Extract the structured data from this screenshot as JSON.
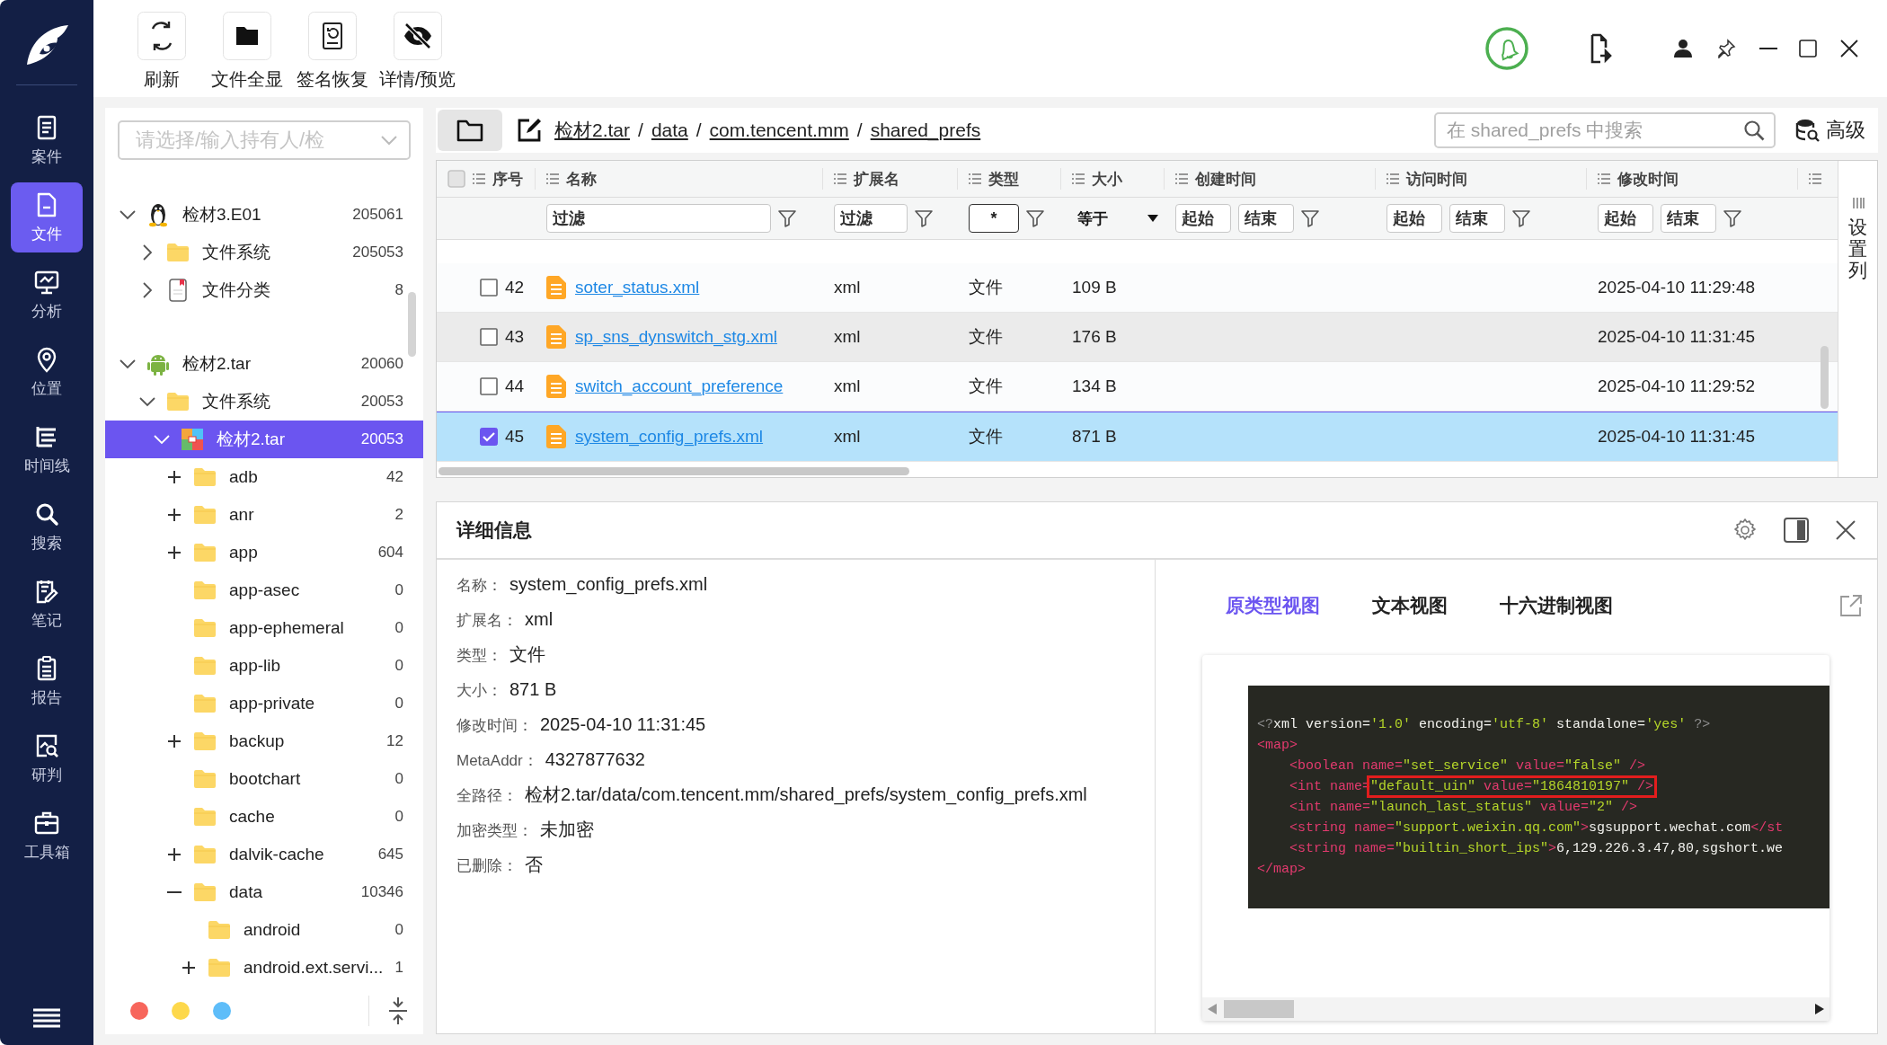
{
  "nav": {
    "items": [
      {
        "label": "案件",
        "selected": false
      },
      {
        "label": "文件",
        "selected": true
      },
      {
        "label": "分析",
        "selected": false
      },
      {
        "label": "位置",
        "selected": false
      },
      {
        "label": "时间线",
        "selected": false
      },
      {
        "label": "搜索",
        "selected": false
      },
      {
        "label": "笔记",
        "selected": false
      },
      {
        "label": "报告",
        "selected": false
      },
      {
        "label": "研判",
        "selected": false
      },
      {
        "label": "工具箱",
        "selected": false
      }
    ]
  },
  "toolbar": {
    "buttons": [
      "刷新",
      "文件全显",
      "签名恢复",
      "详情/预览"
    ]
  },
  "case_selector": {
    "placeholder": "请选择/输入持有人/检"
  },
  "tree": [
    {
      "label": "检材3.E01",
      "count": "205061",
      "kind": "penguin",
      "expanded": true,
      "selected": false,
      "children": [
        {
          "label": "文件系统",
          "count": "205053",
          "kind": "folder",
          "expanded": false,
          "selected": false
        },
        {
          "label": "文件分类",
          "count": "8",
          "kind": "document",
          "expanded": false,
          "selected": false
        }
      ]
    },
    {
      "label": "检材2.tar",
      "count": "20060",
      "kind": "android",
      "expanded": true,
      "selected": false,
      "children": [
        {
          "label": "文件系统",
          "count": "20053",
          "kind": "folder",
          "expanded": true,
          "selected": false,
          "children": [
            {
              "label": "检材2.tar",
              "count": "20053",
              "kind": "archive",
              "expanded": true,
              "selected": true,
              "children": [
                {
                  "label": "adb",
                  "count": "42",
                  "kind": "folder",
                  "expanded": false,
                  "selected": false
                },
                {
                  "label": "anr",
                  "count": "2",
                  "kind": "folder",
                  "expanded": false,
                  "selected": false
                },
                {
                  "label": "app",
                  "count": "604",
                  "kind": "folder",
                  "expanded": false,
                  "selected": false
                },
                {
                  "label": "app-asec",
                  "count": "0",
                  "kind": "folder",
                  "selected": false
                },
                {
                  "label": "app-ephemeral",
                  "count": "0",
                  "kind": "folder",
                  "selected": false
                },
                {
                  "label": "app-lib",
                  "count": "0",
                  "kind": "folder",
                  "selected": false
                },
                {
                  "label": "app-private",
                  "count": "0",
                  "kind": "folder",
                  "selected": false
                },
                {
                  "label": "backup",
                  "count": "12",
                  "kind": "folder",
                  "expanded": false,
                  "selected": false
                },
                {
                  "label": "bootchart",
                  "count": "0",
                  "kind": "folder",
                  "selected": false
                },
                {
                  "label": "cache",
                  "count": "0",
                  "kind": "folder",
                  "selected": false
                },
                {
                  "label": "dalvik-cache",
                  "count": "645",
                  "kind": "folder",
                  "expanded": false,
                  "selected": false
                },
                {
                  "label": "data",
                  "count": "10346",
                  "kind": "folder",
                  "expanded": true,
                  "selected": false,
                  "children": [
                    {
                      "label": "android",
                      "count": "0",
                      "kind": "folder",
                      "selected": false
                    },
                    {
                      "label": "android.ext.servi...",
                      "count": "1",
                      "kind": "folder",
                      "expanded": false,
                      "selected": false
                    }
                  ]
                }
              ]
            }
          ]
        }
      ]
    }
  ],
  "tree_footer": {
    "dots": [
      {
        "color": "#f7665c"
      },
      {
        "color": "#fdd84b"
      },
      {
        "color": "#5ebdf9"
      }
    ]
  },
  "path_bar": {
    "crumbs": [
      "检材2.tar",
      "data",
      "com.tencent.mm",
      "shared_prefs"
    ],
    "separator": "/",
    "search": {
      "placeholder": "在 shared_prefs 中搜索"
    },
    "advanced": "高级"
  },
  "table": {
    "select_all": {
      "checked": false
    },
    "columns": [
      "序号",
      "名称",
      "扩展名",
      "类型",
      "大小",
      "创建时间",
      "访问时间",
      "修改时间"
    ],
    "filters": [
      {
        "kind": "none"
      },
      {
        "kind": "text",
        "placeholder": "过滤"
      },
      {
        "kind": "text",
        "placeholder": "过滤"
      },
      {
        "kind": "value",
        "value": "*"
      },
      {
        "kind": "select",
        "value": "等于"
      },
      {
        "kind": "range",
        "fields": [
          {
            "placeholder": "起始"
          },
          {
            "placeholder": "结束"
          }
        ]
      },
      {
        "kind": "range",
        "fields": [
          {
            "placeholder": "起始"
          },
          {
            "placeholder": "结束"
          }
        ]
      },
      {
        "kind": "range",
        "fields": [
          {
            "placeholder": "起始"
          },
          {
            "placeholder": "结束"
          }
        ]
      }
    ],
    "rows": [
      {
        "index": "42",
        "checked": false,
        "selected": false,
        "hovered": false,
        "name": "soter_status.xml",
        "ext": "xml",
        "type": "文件",
        "size": "109 B",
        "modified": "2025-04-10 11:29:48"
      },
      {
        "index": "43",
        "checked": false,
        "selected": false,
        "hovered": true,
        "name": "sp_sns_dynswitch_stg.xml",
        "ext": "xml",
        "type": "文件",
        "size": "176 B",
        "modified": "2025-04-10 11:31:45"
      },
      {
        "index": "44",
        "checked": false,
        "selected": false,
        "hovered": false,
        "name": "switch_account_preference",
        "ext": "xml",
        "type": "文件",
        "size": "134 B",
        "modified": "2025-04-10 11:29:52"
      },
      {
        "index": "45",
        "checked": true,
        "selected": true,
        "hovered": false,
        "name": "system_config_prefs.xml",
        "ext": "xml",
        "type": "文件",
        "size": "871 B",
        "modified": "2025-04-10 11:31:45"
      }
    ],
    "side_label": "设置列"
  },
  "detail": {
    "title": "详细信息",
    "fields": [
      {
        "label": "名称：",
        "value": "system_config_prefs.xml"
      },
      {
        "label": "扩展名：",
        "value": "xml"
      },
      {
        "label": "类型：",
        "value": "文件"
      },
      {
        "label": "大小：",
        "value": "871 B"
      },
      {
        "label": "修改时间：",
        "value": "2025-04-10 11:31:45"
      },
      {
        "label": "MetaAddr：",
        "value": "4327877632"
      },
      {
        "label": "全路径：",
        "value": "检材2.tar/data/com.tencent.mm/shared_prefs/system_config_prefs.xml"
      },
      {
        "label": "加密类型：",
        "value": "未加密"
      },
      {
        "label": "已删除：",
        "value": "否"
      }
    ],
    "tabs": [
      {
        "label": "原类型视图",
        "selected": true
      },
      {
        "label": "文本视图",
        "selected": false
      },
      {
        "label": "十六进制视图",
        "selected": false
      }
    ],
    "code_lines": [
      [
        {
          "t": "<?",
          "kind": "punct"
        },
        {
          "t": "xml version=",
          "kind": "plain"
        },
        {
          "t": "'1.0'",
          "kind": "value"
        },
        {
          "t": " encoding=",
          "kind": "plain"
        },
        {
          "t": "'utf-8'",
          "kind": "value"
        },
        {
          "t": " standalone=",
          "kind": "plain"
        },
        {
          "t": "'yes'",
          "kind": "value"
        },
        {
          "t": " ?>",
          "kind": "punct"
        }
      ],
      [
        {
          "t": "<map>",
          "kind": "tag"
        }
      ],
      [
        {
          "t": "    <boolean name=",
          "kind": "tag"
        },
        {
          "t": "\"set_service\"",
          "kind": "value"
        },
        {
          "t": " value=",
          "kind": "tag"
        },
        {
          "t": "\"false\"",
          "kind": "value"
        },
        {
          "t": " />",
          "kind": "tag"
        }
      ],
      [
        {
          "t": "    <int name=",
          "kind": "tag"
        },
        {
          "t": "\"default_uin\"",
          "kind": "value",
          "highlight": true
        },
        {
          "t": " value=",
          "kind": "tag",
          "highlight": true
        },
        {
          "t": "\"1864810197\"",
          "kind": "value",
          "highlight": true
        },
        {
          "t": " />",
          "kind": "tag",
          "highlight": true
        }
      ],
      [
        {
          "t": "    <int name=",
          "kind": "tag"
        },
        {
          "t": "\"launch_last_status\"",
          "kind": "value"
        },
        {
          "t": " value=",
          "kind": "tag"
        },
        {
          "t": "\"2\"",
          "kind": "value"
        },
        {
          "t": " />",
          "kind": "tag"
        }
      ],
      [
        {
          "t": "    <string name=",
          "kind": "tag"
        },
        {
          "t": "\"support.weixin.qq.com\"",
          "kind": "value"
        },
        {
          "t": ">",
          "kind": "tag"
        },
        {
          "t": "sgsupport.wechat.com",
          "kind": "plain"
        },
        {
          "t": "</st",
          "kind": "tag"
        }
      ],
      [
        {
          "t": "    <string name=",
          "kind": "tag"
        },
        {
          "t": "\"builtin_short_ips\"",
          "kind": "value"
        },
        {
          "t": ">",
          "kind": "tag"
        },
        {
          "t": "6,129.226.3.47,80,sgshort.we",
          "kind": "plain"
        }
      ],
      [
        {
          "t": "</map>",
          "kind": "tag"
        }
      ]
    ]
  }
}
